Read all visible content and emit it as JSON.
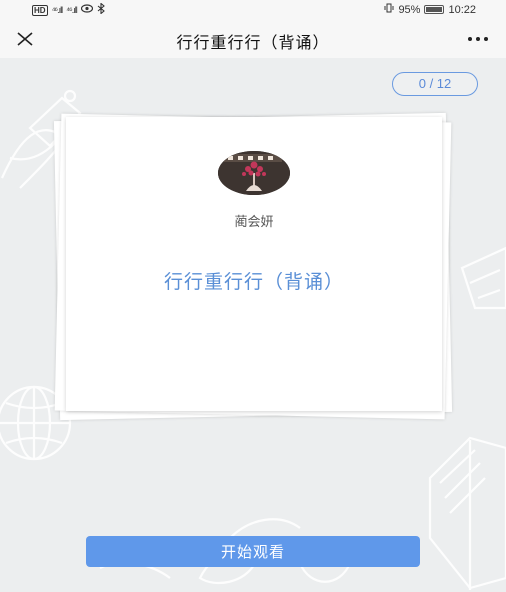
{
  "status_bar": {
    "left_text": "HD",
    "signal1": "⁴⁶.ıll",
    "signal2": "⁴⁶.ıll",
    "battery": "95%",
    "time": "10:22"
  },
  "nav": {
    "title": "行行重行行（背诵）",
    "close_icon": "close-icon",
    "more_icon": "more-icon"
  },
  "counter": "0 / 12",
  "card": {
    "author": "蔺会妍",
    "poem_title": "行行重行行（背诵）"
  },
  "start_button": "开始观看",
  "colors": {
    "accent": "#5f98ea",
    "title_blue": "#5a8fd6",
    "background": "#eceeef"
  }
}
